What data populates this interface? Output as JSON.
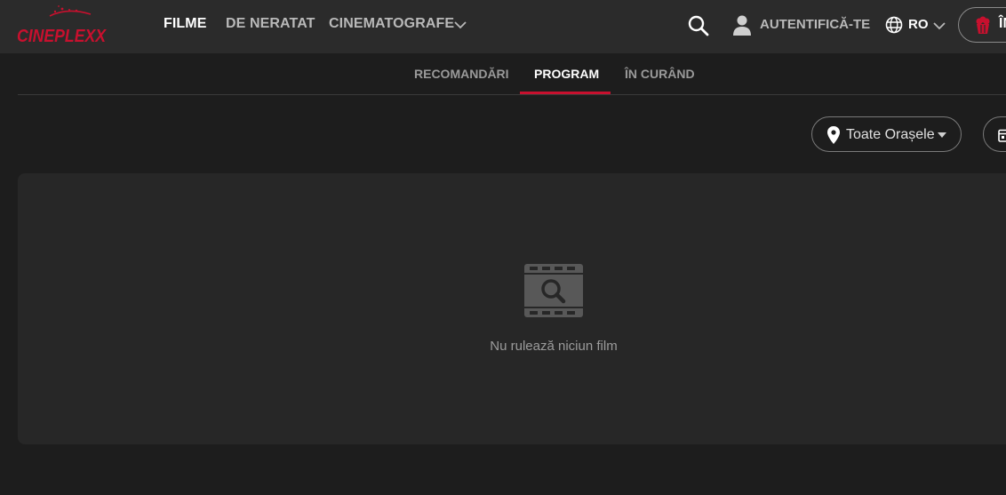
{
  "header": {
    "logo_text": "CINEPLEXX",
    "nav": [
      {
        "label": "FILME",
        "active": true
      },
      {
        "label": "DE NERATAT",
        "active": false
      },
      {
        "label": "CINEMATOGRAFE",
        "active": false,
        "has_dropdown": true
      }
    ],
    "auth_label": "AUTENTIFICĂ-TE",
    "language": "RO",
    "cta_text": "ÎN",
    "icons": {
      "search": "search-icon",
      "user": "user-icon",
      "globe": "globe-icon",
      "cta": "popcorn-icon"
    }
  },
  "tabs": [
    {
      "label": "RECOMANDĂRI",
      "active": false
    },
    {
      "label": "PROGRAM",
      "active": true
    },
    {
      "label": "ÎN CURÂND",
      "active": false
    }
  ],
  "filters": {
    "city_label": "Toate Orașele"
  },
  "empty_state": {
    "message": "Nu rulează niciun film",
    "icon": "film-search-icon"
  },
  "colors": {
    "accent": "#c8102e",
    "header_bg": "#2b2b2b",
    "page_bg": "#1d1d1d",
    "panel_bg": "#272727"
  }
}
